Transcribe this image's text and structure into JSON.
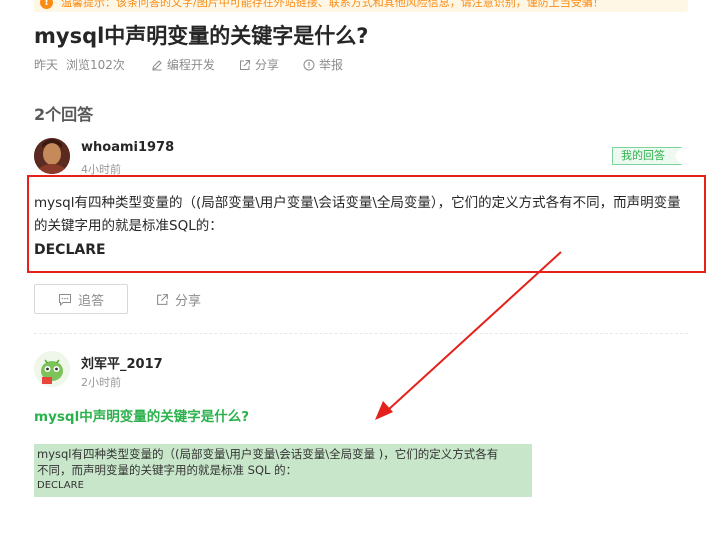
{
  "notice": {
    "icon": "warning-icon",
    "text": "温馨提示：该条问答的文字/图片中可能存在外站链接、联系方式和其他风险信息，请注意识别，谨防上当受骗！"
  },
  "question": {
    "title": "mysql中声明变量的关键字是什么?",
    "meta": {
      "time": "昨天",
      "views": "浏览102次",
      "category": "编程开发",
      "share": "分享",
      "report": "举报"
    }
  },
  "answers_count": "2个回答",
  "answer1": {
    "username": "whoami1978",
    "time": "4小时前",
    "tag": "我的回答",
    "text": "mysql有四种类型变量的（(局部变量\\用户变量\\会话变量\\全局变量），它们的定义方式各有不同，而声明变量的关键字用的就是标准SQL的：",
    "code": "DECLARE",
    "actions": {
      "comment": "追答",
      "share": "分享"
    }
  },
  "answer2": {
    "username": "刘军平_2017",
    "time": "2小时前",
    "question_title": "mysql中声明变量的关键字是什么?",
    "snippet": {
      "line1": "mysql有四种类型变量的（(局部变量\\用户变量\\会话变量\\全局变量 )，它们的定义方式各有",
      "line2": "不同，而声明变量的关键字用的就是标准 SQL 的：",
      "line3": "DECLARE"
    }
  },
  "colors": {
    "accent_green": "#2bb24c",
    "highlight_red": "#e4211b",
    "snippet_bg": "#c8e6c9"
  }
}
